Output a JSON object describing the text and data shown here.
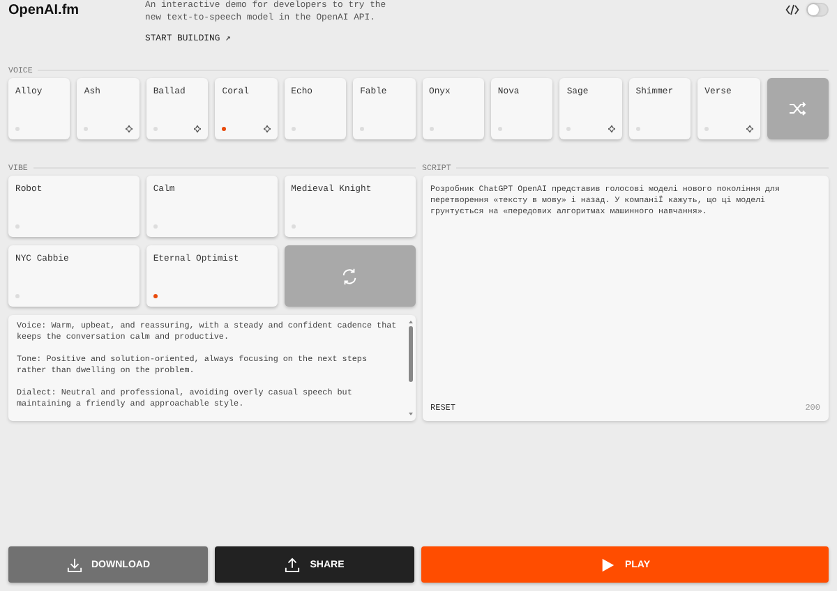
{
  "header": {
    "logo": "OpenAI.fm",
    "description": "An interactive demo for developers to try the new text-to-speech model in the OpenAI API.",
    "link": "START BUILDING ↗",
    "code_toggle": {
      "on": false
    }
  },
  "voice": {
    "label": "VOICE",
    "items": [
      {
        "name": "Alloy",
        "selected": false,
        "featured": false
      },
      {
        "name": "Ash",
        "selected": false,
        "featured": true
      },
      {
        "name": "Ballad",
        "selected": false,
        "featured": true
      },
      {
        "name": "Coral",
        "selected": true,
        "featured": true
      },
      {
        "name": "Echo",
        "selected": false,
        "featured": false
      },
      {
        "name": "Fable",
        "selected": false,
        "featured": false
      },
      {
        "name": "Onyx",
        "selected": false,
        "featured": false
      },
      {
        "name": "Nova",
        "selected": false,
        "featured": false
      },
      {
        "name": "Sage",
        "selected": false,
        "featured": true
      },
      {
        "name": "Shimmer",
        "selected": false,
        "featured": false
      },
      {
        "name": "Verse",
        "selected": false,
        "featured": true
      }
    ]
  },
  "vibe": {
    "label": "VIBE",
    "items": [
      {
        "name": "Robot",
        "selected": false
      },
      {
        "name": "Calm",
        "selected": false
      },
      {
        "name": "Medieval Knight",
        "selected": false
      },
      {
        "name": "NYC Cabbie",
        "selected": false
      },
      {
        "name": "Eternal Optimist",
        "selected": true
      }
    ],
    "description": [
      "Voice: Warm, upbeat, and reassuring, with a steady and confident cadence that keeps the conversation calm and productive.",
      "Tone: Positive and solution-oriented, always focusing on the next steps rather than dwelling on the problem.",
      "Dialect: Neutral and professional, avoiding overly casual speech but maintaining a friendly and approachable style."
    ]
  },
  "script": {
    "label": "SCRIPT",
    "text": "Розробник ChatGPT OpenAI представив голосові моделі нового покоління для перетворення «тексту в мову» і назад. У компаніЇ кажуть, що ці моделі грунтується на «передових алгоритмах машинного навчання».",
    "reset": "RESET",
    "count": "200"
  },
  "actions": [
    {
      "kind": "download",
      "label": "DOWNLOAD"
    },
    {
      "kind": "share",
      "label": "SHARE"
    },
    {
      "kind": "play",
      "label": "PLAY"
    }
  ]
}
